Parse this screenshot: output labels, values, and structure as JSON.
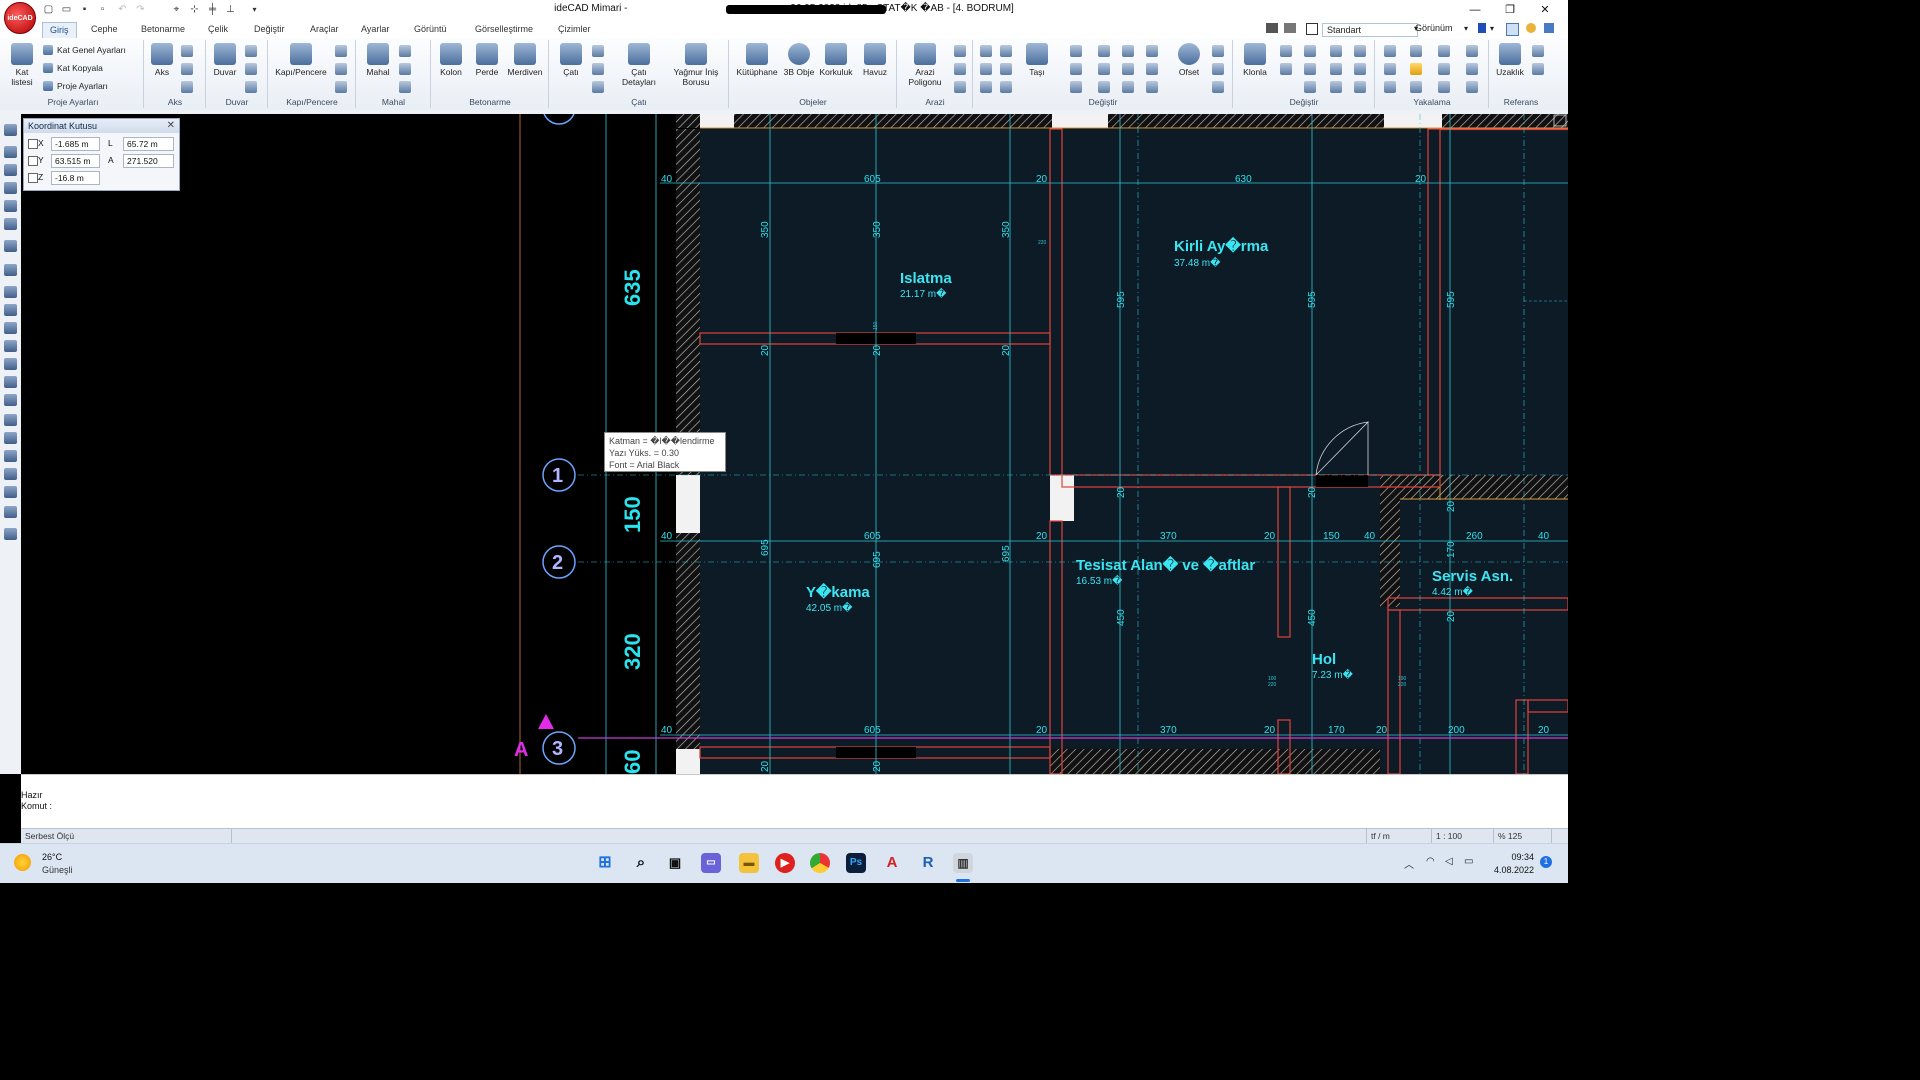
{
  "window": {
    "title": "ideCAD Mimari - ",
    "title_suffix": "26.05.2022.ide85 - STAT�K �AB - [4. BODRUM]",
    "logo": "ideCAD"
  },
  "tabs": [
    "Giriş",
    "Cephe",
    "Betonarme",
    "Çelik",
    "Değiştir",
    "Araçlar",
    "Ayarlar",
    "Görüntü",
    "Görselleştirme",
    "Çizimler"
  ],
  "active_tab": "Giriş",
  "ribbon_right": {
    "style": "Standart",
    "view": "Görünüm"
  },
  "ribbon": {
    "proje": {
      "label": "Proje Ayarları",
      "kat_listesi": "Kat listesi",
      "items": [
        "Kat Genel Ayarları",
        "Kat Kopyala",
        "Proje Ayarları"
      ]
    },
    "aks": {
      "label": "Aks",
      "btn": "Aks"
    },
    "duvar": {
      "label": "Duvar",
      "btn": "Duvar"
    },
    "kapi": {
      "label": "Kapı/Pencere",
      "btn": "Kapı/Pencere"
    },
    "mahal": {
      "label": "Mahal",
      "btn": "Mahal"
    },
    "betonarme": {
      "label": "Betonarme",
      "kolon": "Kolon",
      "perde": "Perde",
      "merdiven": "Merdiven"
    },
    "cati": {
      "label": "Çatı",
      "cati": "Çatı",
      "detay": "Çatı Detayları",
      "yagmur": "Yağmur İniş Borusu"
    },
    "objeler": {
      "label": "Objeler",
      "kutuphane": "Kütüphane",
      "obje3b": "3B Obje",
      "korkuluk": "Korkuluk",
      "havuz": "Havuz"
    },
    "arazi": {
      "label": "Arazi",
      "poligon": "Arazi Poligonu"
    },
    "degistir1": {
      "label": "Değiştir",
      "tasi": "Taşı",
      "ofset": "Ofset"
    },
    "degistir2": {
      "label": "Değiştir",
      "klonla": "Klonla"
    },
    "yakalama": {
      "label": "Yakalama"
    },
    "referans": {
      "label": "Referans",
      "uzaklik": "Uzaklık"
    }
  },
  "coord_box": {
    "title": "Koordinat Kutusu",
    "x": "-1.685 m",
    "y": "63.515 m",
    "z": "-16.8 m",
    "l": "65.72 m",
    "a": "271.520",
    "x_label": "X",
    "y_label": "Y",
    "z_label": "Z",
    "l_label": "L",
    "a_label": "A"
  },
  "tooltip": {
    "line1": "Katman = �l��lendirme",
    "line2": "Yazı Yüks. = 0.30",
    "line3": "Font = Arial Black"
  },
  "drawing": {
    "rooms": [
      {
        "name": "Islatma",
        "area": "21.17 m�"
      },
      {
        "name": "Kirli Ay�rma",
        "area": "37.48 m�"
      },
      {
        "name": "Y�kama",
        "area": "42.05 m�"
      },
      {
        "name": "Tesisat Alan� ve �aftlar",
        "area": "16.53 m�"
      },
      {
        "name": "Servis Asn.",
        "area": "4.42 m�"
      },
      {
        "name": "Hol",
        "area": "7.23 m�"
      }
    ],
    "axis_bubbles": [
      "1",
      "2",
      "3"
    ],
    "section_marker": "A",
    "vertical_dims_big": [
      "635",
      "150",
      "320",
      "60"
    ],
    "row1_dims": [
      "40",
      "605",
      "20",
      "630",
      "20"
    ],
    "row2_dims": [
      "40",
      "605",
      "20",
      "370",
      "20",
      "150",
      "40",
      "260",
      "40"
    ],
    "row3_dims": [
      "40",
      "605",
      "20",
      "370",
      "20",
      "170",
      "20",
      "200",
      "20"
    ],
    "col_dims": [
      "350",
      "350",
      "350",
      "595",
      "595",
      "595",
      "695",
      "695",
      "695",
      "450",
      "450",
      "170",
      "20",
      "20",
      "20",
      "20",
      "20",
      "20",
      "20",
      "20",
      "20"
    ],
    "small_dims": [
      "150",
      "220",
      "100",
      "220",
      "190",
      "220"
    ]
  },
  "command": {
    "line1": "Hazır",
    "line2": "Komut :"
  },
  "status": {
    "mode": "Serbest Ölçü",
    "unit": "tf / m",
    "scale": "1 : 100",
    "zoom": "% 125"
  },
  "taskbar": {
    "weather_temp": "26°C",
    "weather_text": "Güneşli",
    "time": "09:34",
    "date": "4.08.2022",
    "notif": "1"
  }
}
